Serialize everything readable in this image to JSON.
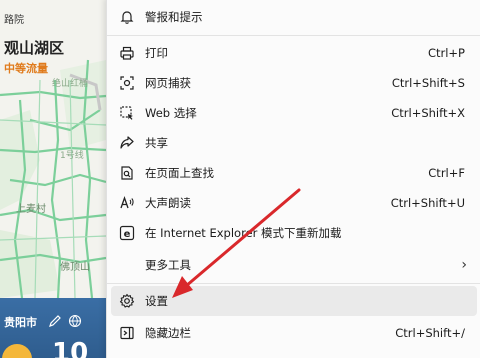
{
  "map": {
    "district_small": "路院",
    "district": "观山湖区",
    "traffic": "中等流量",
    "places": [
      "绝山红桶",
      "1号线",
      "上麦村",
      "佛顶山"
    ],
    "weather_city": "贵阳市",
    "temperature": "10"
  },
  "menu": {
    "items": [
      {
        "label": "警报和提示",
        "shortcut": "",
        "icon": "bell-icon"
      },
      {
        "label": "打印",
        "shortcut": "Ctrl+P",
        "icon": "printer-icon"
      },
      {
        "label": "网页捕获",
        "shortcut": "Ctrl+Shift+S",
        "icon": "web-capture-icon"
      },
      {
        "label": "Web 选择",
        "shortcut": "Ctrl+Shift+X",
        "icon": "web-select-icon"
      },
      {
        "label": "共享",
        "shortcut": "",
        "icon": "share-icon"
      },
      {
        "label": "在页面上查找",
        "shortcut": "Ctrl+F",
        "icon": "find-icon"
      },
      {
        "label": "大声朗读",
        "shortcut": "Ctrl+Shift+U",
        "icon": "read-aloud-icon"
      },
      {
        "label": "在 Internet Explorer 模式下重新加载",
        "shortcut": "",
        "icon": "ie-icon"
      },
      {
        "label": "更多工具",
        "shortcut": "",
        "icon": ""
      },
      {
        "label": "设置",
        "shortcut": "",
        "icon": "gear-icon"
      },
      {
        "label": "隐藏边栏",
        "shortcut": "Ctrl+Shift+/",
        "icon": "sidebar-icon"
      }
    ],
    "submenu_chevron": "›",
    "hover_color": "#eaeaea",
    "annotation_color": "#d9282b"
  }
}
